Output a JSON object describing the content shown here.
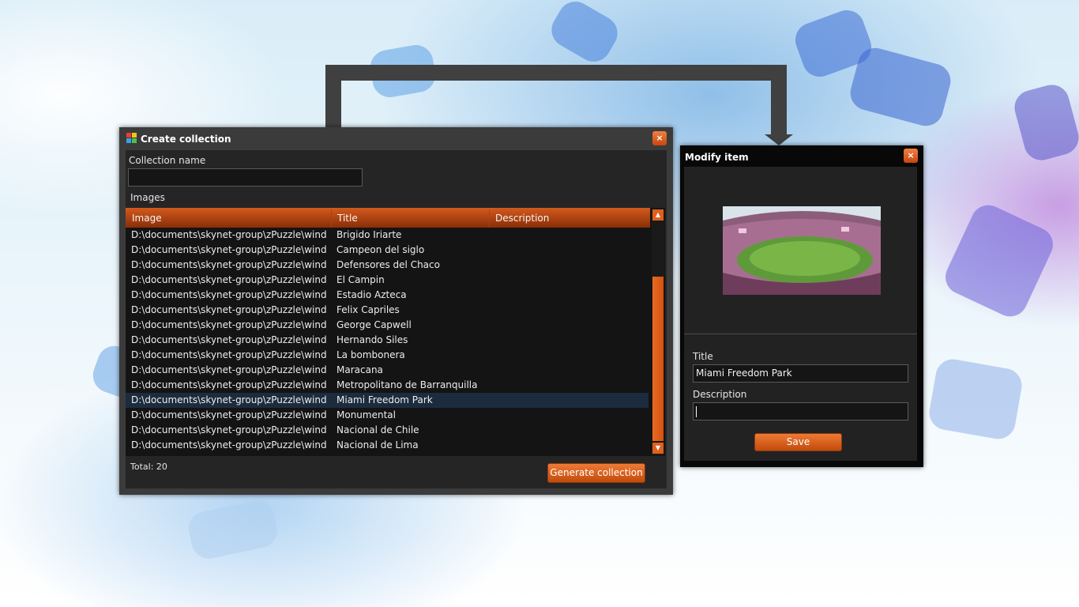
{
  "create_window": {
    "title": "Create collection",
    "close_glyph": "×",
    "collection_name_label": "Collection name",
    "collection_name_value": "",
    "images_label": "Images",
    "columns": [
      "Image",
      "Title",
      "Description"
    ],
    "rows": [
      {
        "image": "D:\\documents\\skynet-group\\zPuzzle\\windo...",
        "title": "Brigido Iriarte",
        "description": ""
      },
      {
        "image": "D:\\documents\\skynet-group\\zPuzzle\\windo...",
        "title": "Campeon del siglo",
        "description": ""
      },
      {
        "image": "D:\\documents\\skynet-group\\zPuzzle\\windo...",
        "title": "Defensores del Chaco",
        "description": ""
      },
      {
        "image": "D:\\documents\\skynet-group\\zPuzzle\\windo...",
        "title": "El Campin",
        "description": ""
      },
      {
        "image": "D:\\documents\\skynet-group\\zPuzzle\\windo...",
        "title": "Estadio Azteca",
        "description": ""
      },
      {
        "image": "D:\\documents\\skynet-group\\zPuzzle\\windo...",
        "title": "Felix Capriles",
        "description": ""
      },
      {
        "image": "D:\\documents\\skynet-group\\zPuzzle\\windo...",
        "title": "George Capwell",
        "description": ""
      },
      {
        "image": "D:\\documents\\skynet-group\\zPuzzle\\windo...",
        "title": "Hernando Siles",
        "description": ""
      },
      {
        "image": "D:\\documents\\skynet-group\\zPuzzle\\windo...",
        "title": "La bombonera",
        "description": ""
      },
      {
        "image": "D:\\documents\\skynet-group\\zPuzzle\\windo...",
        "title": "Maracana",
        "description": ""
      },
      {
        "image": "D:\\documents\\skynet-group\\zPuzzle\\windo...",
        "title": "Metropolitano de Barranquilla",
        "description": ""
      },
      {
        "image": "D:\\documents\\skynet-group\\zPuzzle\\windo...",
        "title": "Miami Freedom Park",
        "description": ""
      },
      {
        "image": "D:\\documents\\skynet-group\\zPuzzle\\windo...",
        "title": "Monumental",
        "description": ""
      },
      {
        "image": "D:\\documents\\skynet-group\\zPuzzle\\windo...",
        "title": "Nacional de Chile",
        "description": ""
      },
      {
        "image": "D:\\documents\\skynet-group\\zPuzzle\\windo...",
        "title": "Nacional de Lima",
        "description": ""
      }
    ],
    "selected_row": 11,
    "total_label": "Total: 20",
    "generate_button": "Generate collection",
    "scroll_up_glyph": "▲",
    "scroll_down_glyph": "▼"
  },
  "modify_window": {
    "title": "Modify item",
    "close_glyph": "×",
    "title_label": "Title",
    "title_value": "Miami Freedom Park",
    "description_label": "Description",
    "description_value": "",
    "save_button": "Save"
  },
  "colors": {
    "accent_orange": "#d9571a",
    "window_dark": "#242424",
    "selection_blue": "#1c2c3e"
  },
  "icons": [
    "app-icon",
    "close-icon",
    "scroll-up-icon",
    "scroll-down-icon",
    "stadium-thumbnail"
  ]
}
